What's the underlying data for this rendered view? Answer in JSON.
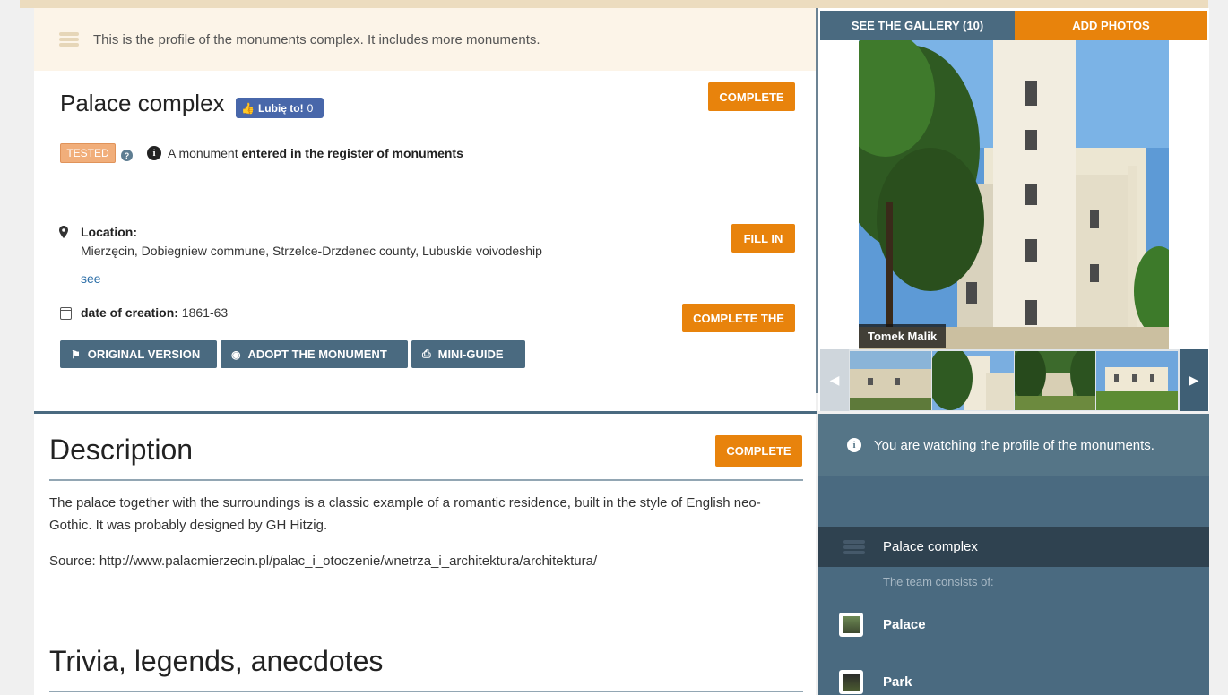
{
  "notice": {
    "text": "This is the profile of the monuments complex. It includes more monuments."
  },
  "header": {
    "title": "Palace complex",
    "fb_like_label": "Lubię to!",
    "fb_like_count": "0",
    "complete_label": "COMPLETE",
    "tested_badge": "TESTED",
    "help_mark": "?",
    "info_mark": "i",
    "register_prefix": "A monument",
    "register_bold": "entered in the register of monuments"
  },
  "location": {
    "label": "Location:",
    "value": "Mierzęcin, Dobiegniew commune, Strzelce-Drzdenec county, Lubuskie voivodeship",
    "see_link": "see",
    "fill_in_label": "FILL IN"
  },
  "creation": {
    "label": "date of creation:",
    "value": "1861-63",
    "complete_the_label": "COMPLETE THE"
  },
  "actions": {
    "original_version": "ORIGINAL VERSION",
    "adopt": "ADOPT THE MONUMENT",
    "mini_guide": "MINI-GUIDE"
  },
  "gallery": {
    "see_gallery": "SEE THE GALLERY (10)",
    "add_photos": "ADD PHOTOS",
    "credit": "Tomek Malik",
    "prev_arrow": "◀",
    "next_arrow": "▶"
  },
  "description": {
    "heading": "Description",
    "complete_label": "COMPLETE",
    "text": "The palace together with the surroundings is a classic example of a romantic residence, built in the style of English neo-Gothic. It was probably designed by GH Hitzig.",
    "source": "Source: http://www.palacmierzecin.pl/palac_i_otoczenie/wnetrza_i_architektura/architektura/"
  },
  "trivia": {
    "heading": "Trivia, legends, anecdotes"
  },
  "sidebar": {
    "watch_text": "You are watching the profile of the monuments.",
    "complex_name": "Palace complex",
    "team_label": "The team consists of:",
    "members": [
      {
        "name": "Palace"
      },
      {
        "name": "Park"
      }
    ]
  },
  "colors": {
    "accent_orange": "#e8830c",
    "slate": "#4a6a80",
    "notice_bg": "#fcf4e8"
  }
}
